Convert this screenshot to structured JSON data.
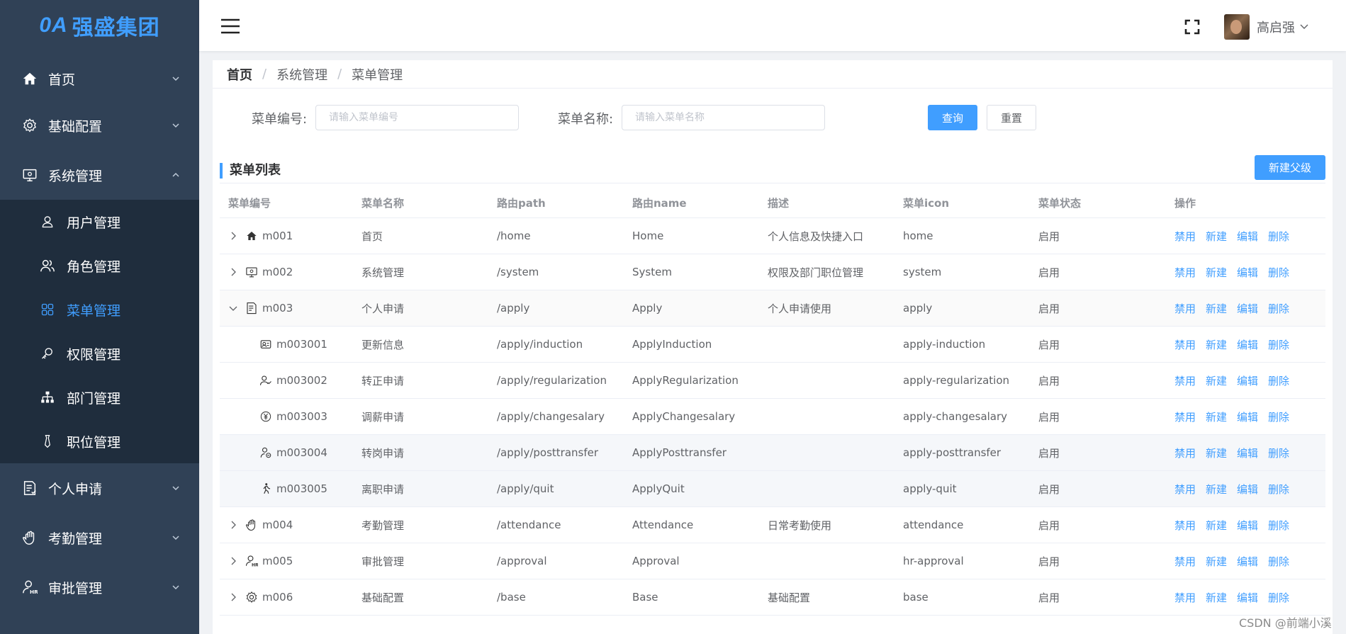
{
  "app": {
    "logo_mark": "0A",
    "logo_text": "强盛集团"
  },
  "sidebar": {
    "items": [
      {
        "label": "首页",
        "icon": "home-icon"
      },
      {
        "label": "基础配置",
        "icon": "gear-icon"
      },
      {
        "label": "系统管理",
        "icon": "monitor-icon",
        "expanded": true
      },
      {
        "label": "个人申请",
        "icon": "document-icon"
      },
      {
        "label": "考勤管理",
        "icon": "hand-icon"
      },
      {
        "label": "审批管理",
        "icon": "hr-user-icon"
      }
    ],
    "sub_items": [
      {
        "label": "用户管理",
        "icon": "user-icon"
      },
      {
        "label": "角色管理",
        "icon": "users-icon"
      },
      {
        "label": "菜单管理",
        "icon": "grid-icon",
        "active": true
      },
      {
        "label": "权限管理",
        "icon": "key-icon"
      },
      {
        "label": "部门管理",
        "icon": "org-chart-icon"
      },
      {
        "label": "职位管理",
        "icon": "tie-icon"
      }
    ]
  },
  "header": {
    "username": "高启强"
  },
  "breadcrumb": {
    "home": "首页",
    "parent": "系统管理",
    "current": "菜单管理",
    "separator": "/"
  },
  "filter": {
    "code_label": "菜单编号:",
    "code_placeholder": "请输入菜单编号",
    "name_label": "菜单名称:",
    "name_placeholder": "请输入菜单名称",
    "query_button": "查询",
    "reset_button": "重置"
  },
  "list": {
    "title": "菜单列表",
    "new_parent_button": "新建父级"
  },
  "table": {
    "headers": [
      "菜单编号",
      "菜单名称",
      "路由path",
      "路由name",
      "描述",
      "菜单icon",
      "菜单状态",
      "操作"
    ],
    "actions": [
      "禁用",
      "新建",
      "编辑",
      "删除"
    ],
    "rows": [
      {
        "code": "m001",
        "name": "首页",
        "path": "/home",
        "route_name": "Home",
        "desc": "个人信息及快捷入口",
        "icon": "home",
        "status": "启用"
      },
      {
        "code": "m002",
        "name": "系统管理",
        "path": "/system",
        "route_name": "System",
        "desc": "权限及部门职位管理",
        "icon": "system",
        "status": "启用"
      },
      {
        "code": "m003",
        "name": "个人申请",
        "path": "/apply",
        "route_name": "Apply",
        "desc": "个人申请使用",
        "icon": "apply",
        "status": "启用"
      },
      {
        "code": "m003001",
        "name": "更新信息",
        "path": "/apply/induction",
        "route_name": "ApplyInduction",
        "desc": "",
        "icon": "apply-induction",
        "status": "启用"
      },
      {
        "code": "m003002",
        "name": "转正申请",
        "path": "/apply/regularization",
        "route_name": "ApplyRegularization",
        "desc": "",
        "icon": "apply-regularization",
        "status": "启用"
      },
      {
        "code": "m003003",
        "name": "调薪申请",
        "path": "/apply/changesalary",
        "route_name": "ApplyChangesalary",
        "desc": "",
        "icon": "apply-changesalary",
        "status": "启用"
      },
      {
        "code": "m003004",
        "name": "转岗申请",
        "path": "/apply/posttransfer",
        "route_name": "ApplyPosttransfer",
        "desc": "",
        "icon": "apply-posttransfer",
        "status": "启用"
      },
      {
        "code": "m003005",
        "name": "离职申请",
        "path": "/apply/quit",
        "route_name": "ApplyQuit",
        "desc": "",
        "icon": "apply-quit",
        "status": "启用"
      },
      {
        "code": "m004",
        "name": "考勤管理",
        "path": "/attendance",
        "route_name": "Attendance",
        "desc": "日常考勤使用",
        "icon": "attendance",
        "status": "启用"
      },
      {
        "code": "m005",
        "name": "审批管理",
        "path": "/approval",
        "route_name": "Approval",
        "desc": "",
        "icon": "hr-approval",
        "status": "启用"
      },
      {
        "code": "m006",
        "name": "基础配置",
        "path": "/base",
        "route_name": "Base",
        "desc": "基础配置",
        "icon": "base",
        "status": "启用"
      }
    ]
  },
  "watermark": "CSDN @前端小溪",
  "colors": {
    "sidebar_bg": "#304156",
    "accent": "#409eff",
    "submenu_bg": "#1f2d3d"
  }
}
